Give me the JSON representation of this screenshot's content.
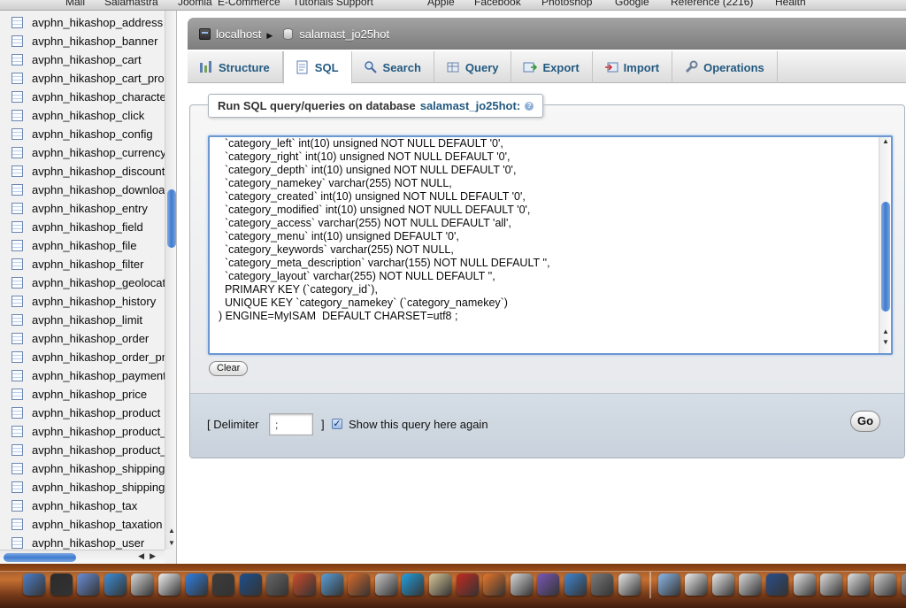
{
  "bookmarks": [
    "Mail",
    "Salamastra",
    "Joomla",
    "E-Commerce",
    "Tutorials Support",
    "Apple",
    "Facebook",
    "Photoshop",
    "Google",
    "Reference (2216)",
    "Health"
  ],
  "navigation": {
    "tables": [
      "avphn_hikashop_address",
      "avphn_hikashop_banner",
      "avphn_hikashop_cart",
      "avphn_hikashop_cart_product",
      "avphn_hikashop_characteristic",
      "avphn_hikashop_click",
      "avphn_hikashop_config",
      "avphn_hikashop_currency",
      "avphn_hikashop_discount",
      "avphn_hikashop_download",
      "avphn_hikashop_entry",
      "avphn_hikashop_field",
      "avphn_hikashop_file",
      "avphn_hikashop_filter",
      "avphn_hikashop_geolocation",
      "avphn_hikashop_history",
      "avphn_hikashop_limit",
      "avphn_hikashop_order",
      "avphn_hikashop_order_product",
      "avphn_hikashop_payment",
      "avphn_hikashop_price",
      "avphn_hikashop_product",
      "avphn_hikashop_product_",
      "avphn_hikashop_product_",
      "avphn_hikashop_shipping",
      "avphn_hikashop_shipping",
      "avphn_hikashop_tax",
      "avphn_hikashop_taxation",
      "avphn_hikashop_user"
    ]
  },
  "breadcrumb": {
    "server": "localhost",
    "database": "salamast_jo25hot"
  },
  "tabs": [
    {
      "label": "Structure",
      "icon": "structure-icon"
    },
    {
      "label": "SQL",
      "icon": "sql-icon",
      "active": true
    },
    {
      "label": "Search",
      "icon": "search-icon"
    },
    {
      "label": "Query",
      "icon": "query-icon"
    },
    {
      "label": "Export",
      "icon": "export-icon"
    },
    {
      "label": "Import",
      "icon": "import-icon"
    },
    {
      "label": "Operations",
      "icon": "wrench-icon"
    }
  ],
  "query_panel": {
    "legend_prefix": "Run SQL query/queries on database",
    "legend_db": "salamast_jo25hot:",
    "sql_lines": [
      "  `category_left` int(10) unsigned NOT NULL DEFAULT '0',",
      "  `category_right` int(10) unsigned NOT NULL DEFAULT '0',",
      "  `category_depth` int(10) unsigned NOT NULL DEFAULT '0',",
      "  `category_namekey` varchar(255) NOT NULL,",
      "  `category_created` int(10) unsigned NOT NULL DEFAULT '0',",
      "  `category_modified` int(10) unsigned NOT NULL DEFAULT '0',",
      "  `category_access` varchar(255) NOT NULL DEFAULT 'all',",
      "  `category_menu` int(10) unsigned DEFAULT '0',",
      "  `category_keywords` varchar(255) NOT NULL,",
      "  `category_meta_description` varchar(155) NOT NULL DEFAULT '',",
      "  `category_layout` varchar(255) NOT NULL DEFAULT '',",
      "  PRIMARY KEY (`category_id`),",
      "  UNIQUE KEY `category_namekey` (`category_namekey`)",
      ") ENGINE=MyISAM  DEFAULT CHARSET=utf8 ;"
    ],
    "clear_label": "Clear",
    "delimiter_label": "[ Delimiter",
    "delimiter_value": ";",
    "delimiter_close": "]",
    "show_again_label": "Show this query here again",
    "show_again_checked": true,
    "go_label": "Go"
  },
  "dock": {
    "colors": [
      "#4d7fc9",
      "#2b2b2b",
      "#6a8fd8",
      "#3c8ed8",
      "#d8d8d8",
      "#f2f2f2",
      "#2f7fe0",
      "#3c3c3c",
      "#1d4f8c",
      "#666666",
      "#c94b2b",
      "#5aa0d8",
      "#d86a2b",
      "#c7c7c7",
      "#21a0e0",
      "#d9c89a",
      "#c42b1f",
      "#e8762b",
      "#d9d9d9",
      "#7a58b8",
      "#3f86d1",
      "#7a7a7a",
      "#e9e9e9",
      "#8cb8e8",
      "#f0f0f0",
      "#eaeaea",
      "#dcdcdc",
      "#2a4f8a",
      "#e6e6e6",
      "#dedede",
      "#e3e3e3",
      "#cfcfcf",
      "#9a9a9a"
    ]
  }
}
